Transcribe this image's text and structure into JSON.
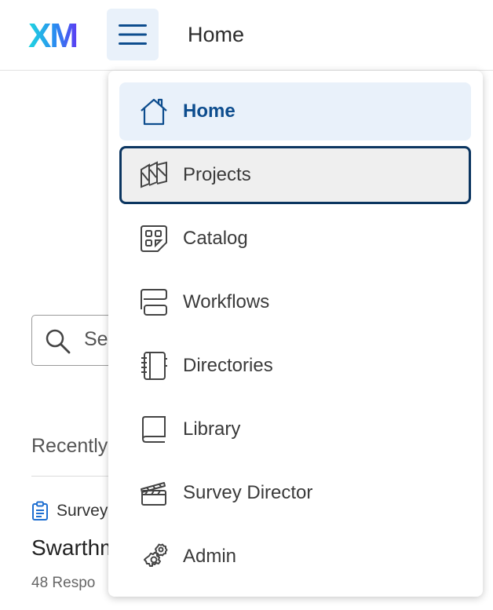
{
  "header": {
    "logo_text": "XM",
    "title": "Home"
  },
  "background": {
    "search_placeholder": "Se",
    "recent_label": "Recently",
    "item_type": "Survey",
    "project_name": "Swarthm",
    "responses": "48 Respo"
  },
  "menu": {
    "items": [
      {
        "label": "Home",
        "icon": "home-icon",
        "state": "active"
      },
      {
        "label": "Projects",
        "icon": "projects-icon",
        "state": "focused"
      },
      {
        "label": "Catalog",
        "icon": "catalog-icon",
        "state": ""
      },
      {
        "label": "Workflows",
        "icon": "workflows-icon",
        "state": ""
      },
      {
        "label": "Directories",
        "icon": "directories-icon",
        "state": ""
      },
      {
        "label": "Library",
        "icon": "library-icon",
        "state": ""
      },
      {
        "label": "Survey Director",
        "icon": "survey-director-icon",
        "state": ""
      },
      {
        "label": "Admin",
        "icon": "admin-icon",
        "state": ""
      }
    ]
  },
  "colors": {
    "accent": "#0d4d8e",
    "active_bg": "#e9f1fa",
    "focus_border": "#0b3560",
    "logo_start": "#21d4e8",
    "logo_end": "#5a3cf0"
  }
}
